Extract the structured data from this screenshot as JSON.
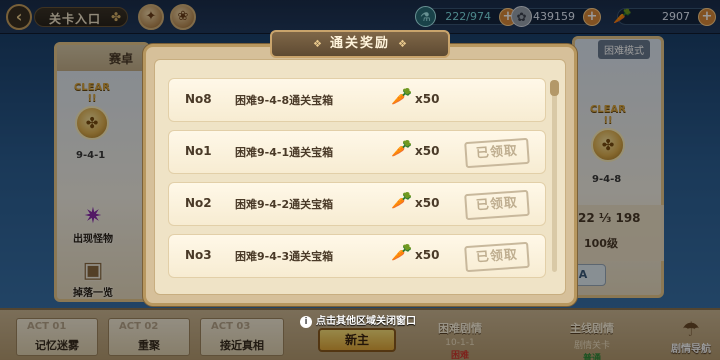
{
  "topbar": {
    "title": "关卡入口",
    "energy": "222/974",
    "coins": "439159",
    "carrots": "2907"
  },
  "stage_left": {
    "title_partial": "赛卓",
    "clear_label": "CLEAR !!",
    "stage_code": "9-4-1",
    "monsters_label": "出现怪物",
    "drops_label": "掉落一览"
  },
  "stage_right": {
    "mode_label": "困难模式",
    "clear_label": "CLEAR !!",
    "stage_code": "9-4-8",
    "progress": "22 ⅓ 198",
    "level": "100级",
    "button_label": "A"
  },
  "modal": {
    "title": "通关奖励",
    "rewards": [
      {
        "no": "No8",
        "name": "困难9-4-8通关宝箱",
        "qty": "x50",
        "claimed": ""
      },
      {
        "no": "No1",
        "name": "困难9-4-1通关宝箱",
        "qty": "x50",
        "claimed": "已领取"
      },
      {
        "no": "No2",
        "name": "困难9-4-2通关宝箱",
        "qty": "x50",
        "claimed": "已领取"
      },
      {
        "no": "No3",
        "name": "困难9-4-3通关宝箱",
        "qty": "x50",
        "claimed": "已领取"
      }
    ],
    "hint": "点击其他区域关闭窗口"
  },
  "bottombar": {
    "acts": [
      {
        "code": "ACT 01",
        "name": "记忆迷雾"
      },
      {
        "code": "ACT 02",
        "name": "重聚"
      },
      {
        "code": "ACT 03",
        "name": "接近真相"
      }
    ],
    "newbie_label": "新主",
    "hard_story": {
      "title": "困难剧情",
      "sub": "10-1-1",
      "tag": "困难"
    },
    "main_story": {
      "title": "主线剧情",
      "sub": "剧情关卡",
      "tag": "普通"
    },
    "guide_label": "剧情导航"
  },
  "colors": {
    "panel_bg": "#efe3c6",
    "row_bg": "#fff8e8",
    "accent_orange": "#e27a1e",
    "title_brown": "#6e583c",
    "energy_teal": "#7fe0e6"
  },
  "icons": {
    "back": "back-arrow-icon",
    "carrot": "carrot-icon",
    "energy": "energy-jar-icon",
    "coin": "coin-icon"
  }
}
